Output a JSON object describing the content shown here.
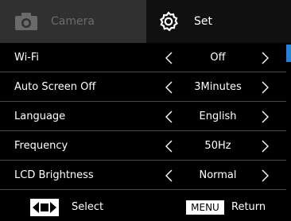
{
  "tabs": {
    "camera": {
      "label": "Camera",
      "icon": "camera-icon",
      "active": false
    },
    "set": {
      "label": "Set",
      "icon": "gear-icon",
      "active": true
    }
  },
  "settings": [
    {
      "name": "Wi-Fi",
      "value": "Off"
    },
    {
      "name": "Auto Screen Off",
      "value": "3Minutes"
    },
    {
      "name": "Language",
      "value": "English"
    },
    {
      "name": "Frequency",
      "value": "50Hz"
    },
    {
      "name": "LCD Brightness",
      "value": "Normal"
    }
  ],
  "footer": {
    "select_icon": "dpad-left-right-icon",
    "select_label": "Select",
    "menu_key": "MENU",
    "return_label": "Return"
  },
  "colors": {
    "accent": "#2a7fd4",
    "background": "#000000",
    "tab_inactive_bg": "#303030"
  }
}
